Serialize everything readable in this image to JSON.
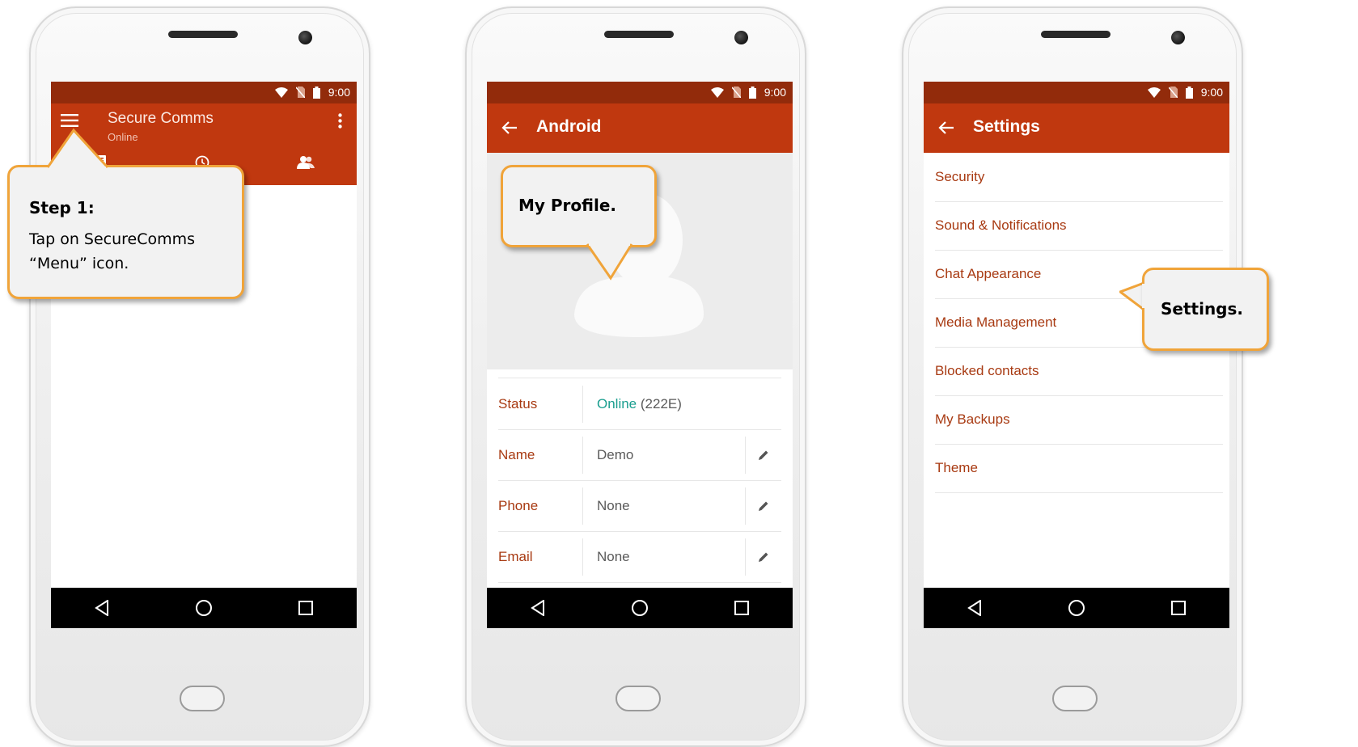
{
  "status_bar": {
    "time": "9:00"
  },
  "screen1": {
    "title": "Secure Comms",
    "subtitle": "Online",
    "callout_title": "Step 1:",
    "callout_text_line1": "Tap on SecureComms",
    "callout_text_line2": "“Menu” icon."
  },
  "screen2": {
    "title": "Android",
    "callout": "My Profile.",
    "rows": [
      {
        "label": "Status",
        "value_status": "Online",
        "value_extra": "(222E)"
      },
      {
        "label": "Name",
        "value": "Demo"
      },
      {
        "label": "Phone",
        "value": "None"
      },
      {
        "label": "Email",
        "value": "None"
      }
    ],
    "status_color": "#1a9e8f"
  },
  "screen3": {
    "title": "Settings",
    "callout": "Settings.",
    "items": [
      "Security",
      "Sound & Notifications",
      "Chat Appearance",
      "Media Management",
      "Blocked contacts",
      "My Backups",
      "Theme"
    ]
  },
  "colors": {
    "accent": "#c0380f",
    "status_bar": "#922b0b",
    "label": "#a83a12",
    "callout_border": "#f0a43a"
  },
  "icons": [
    "wifi-icon",
    "no-sim-icon",
    "battery-icon",
    "menu-icon",
    "more-vert-icon",
    "chats-tab-icon",
    "clock-icon",
    "contacts-icon",
    "back-arrow-icon",
    "edit-pencil-icon",
    "nav-back-icon",
    "nav-home-icon",
    "nav-recents-icon"
  ]
}
